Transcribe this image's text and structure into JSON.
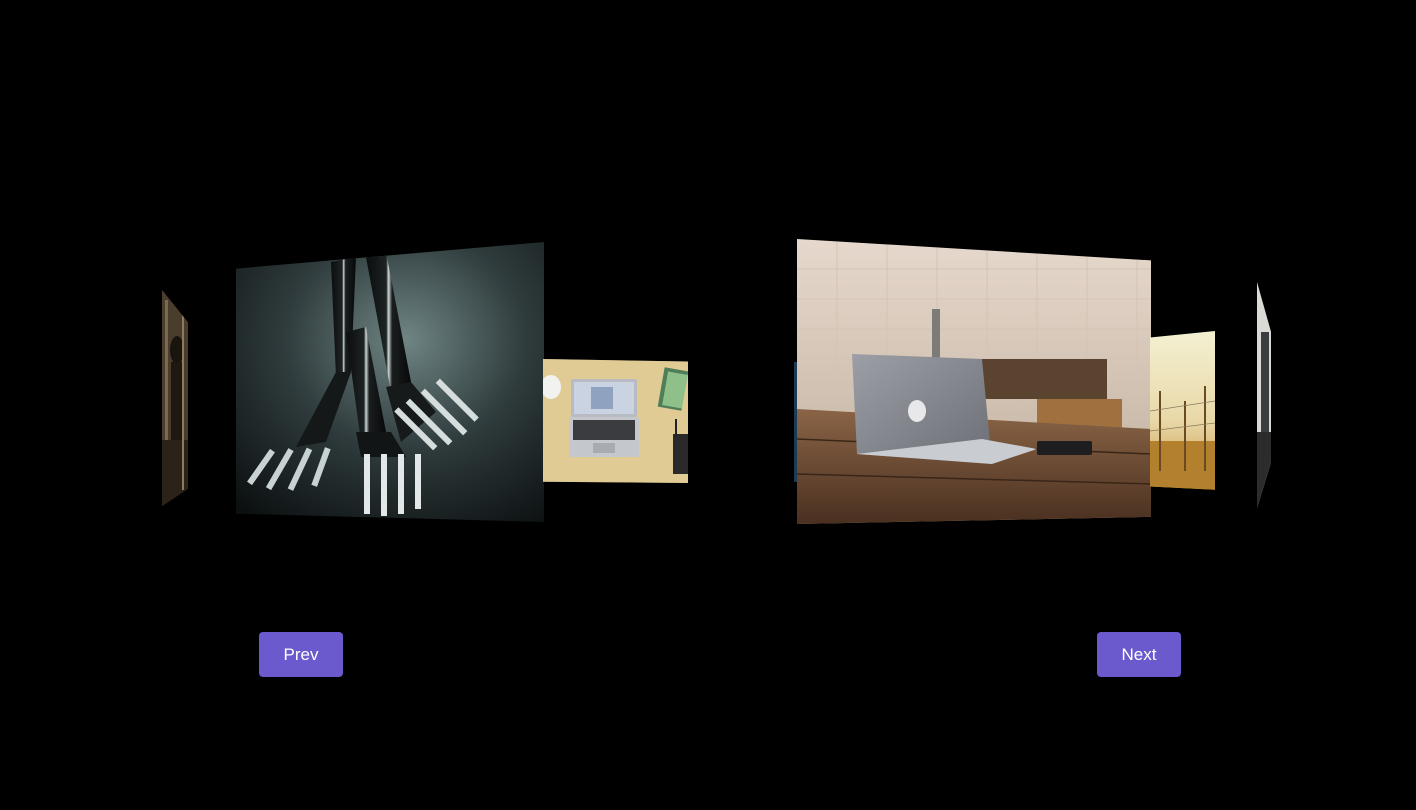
{
  "carousel": {
    "slides": [
      {
        "name": "stone-figure",
        "icon": "image-stone-figure"
      },
      {
        "name": "forks",
        "icon": "image-forks"
      },
      {
        "name": "laptop-desk-topdown",
        "icon": "image-laptop-desk"
      },
      {
        "name": "sliver",
        "icon": "image-sliver"
      },
      {
        "name": "laptop-cafe-table",
        "icon": "image-laptop-cafe"
      },
      {
        "name": "fence-field",
        "icon": "image-fence-field"
      },
      {
        "name": "statue",
        "icon": "image-statue"
      }
    ]
  },
  "controls": {
    "prev_label": "Prev",
    "next_label": "Next",
    "button_color": "#6a5acd",
    "button_text_color": "#ffffff"
  },
  "theme": {
    "background": "#000000"
  }
}
